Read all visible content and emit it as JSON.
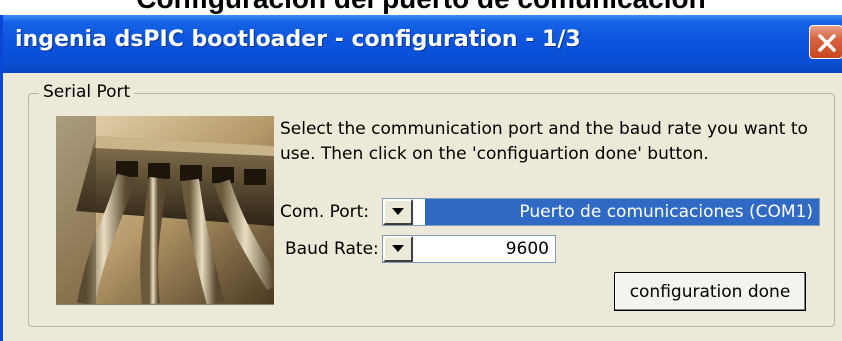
{
  "page": {
    "caption": "Configuración del puerto de comunicación"
  },
  "window": {
    "title": "ingenia dsPIC bootloader - configuration - 1/3",
    "close_icon": "close-x-icon"
  },
  "serial_port": {
    "legend": "Serial Port",
    "image": "network-cables-photo",
    "description": "Select the communication port and the baud rate you want to use. Then click on the 'configuartion done' button.",
    "com_port": {
      "label": "Com. Port:",
      "value": "Puerto de comunicaciones (COM1)",
      "dropdown_icon": "chevron-down-icon"
    },
    "baud_rate": {
      "label": "Baud Rate:",
      "value": "9600",
      "dropdown_icon": "chevron-down-icon"
    },
    "done_button": "configuration done"
  },
  "colors": {
    "titlebar": "#0a4fd6",
    "window_bg": "#ece9d8",
    "selection": "#316ac5",
    "close_button": "#d8643f"
  }
}
